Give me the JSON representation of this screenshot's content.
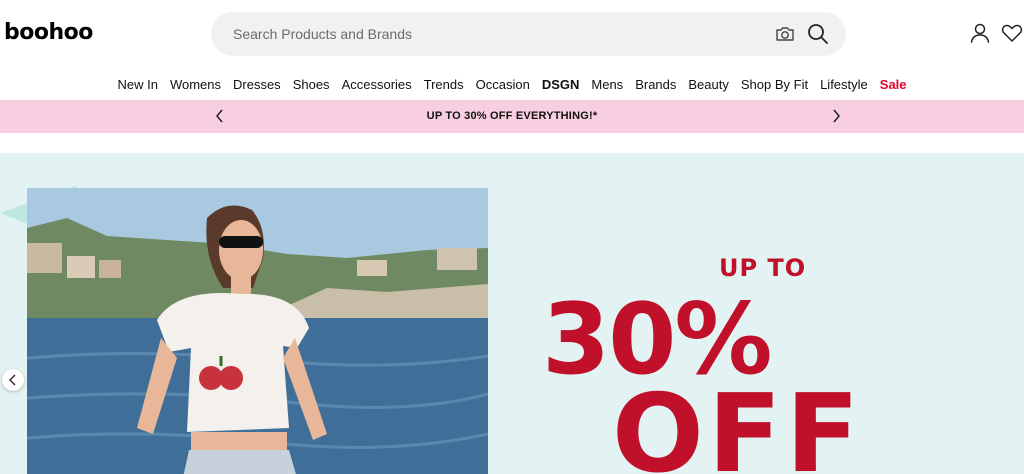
{
  "header": {
    "logo_text": "boohoo",
    "search_placeholder": "Search Products and Brands",
    "icons": [
      "camera-icon",
      "search-icon",
      "account-icon",
      "wishlist-heart-icon"
    ]
  },
  "nav": {
    "items": [
      "New In",
      "Womens",
      "Dresses",
      "Shoes",
      "Accessories",
      "Trends",
      "Occasion",
      "DSGN",
      "Mens",
      "Brands",
      "Beauty",
      "Shop By Fit",
      "Lifestyle",
      "Sale"
    ]
  },
  "promo": {
    "text": "UP TO 30% OFF EVERYTHING!*",
    "background": "#f8cfe0"
  },
  "hero": {
    "line1": "UP TO",
    "line2": "30%",
    "line3": "OFF",
    "accent_color": "#c0102a",
    "background": "#e3f3f3",
    "image_description": "woman in white cherry print crop top by the sea"
  },
  "colors": {
    "sale": "#e4002b"
  }
}
